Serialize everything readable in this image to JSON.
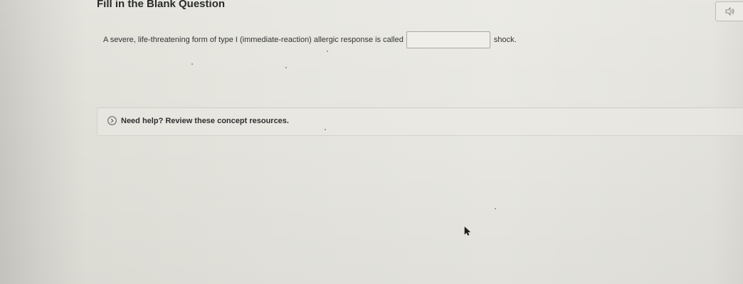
{
  "question": {
    "heading": "Fill in the Blank Question",
    "prompt": "A severe, life-threatening form of type I (immediate-reaction) allergic response is called",
    "answer_value": "",
    "suffix": "shock."
  },
  "help": {
    "label": "Need help? Review these concept resources."
  },
  "icons": {
    "audio": "speaker-icon",
    "help_toggle": "chevron-right-circle-icon",
    "cursor": "mouse-pointer-icon"
  },
  "colors": {
    "text": "#2d2d2d",
    "border": "#a9a9a4",
    "background": "#e6e5df"
  }
}
